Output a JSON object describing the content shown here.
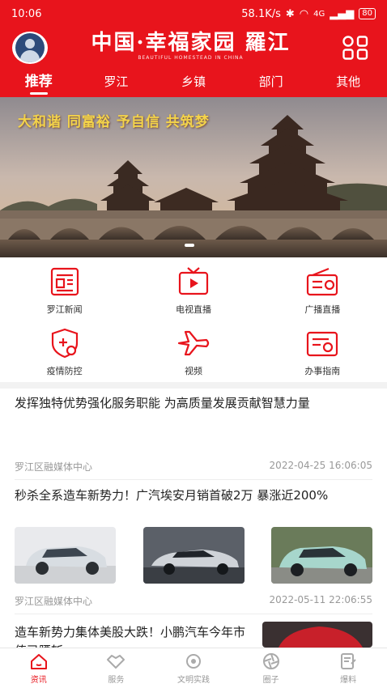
{
  "status_bar": {
    "time": "10:06",
    "network_speed": "58.1K/s",
    "signal": "4G",
    "battery": "80"
  },
  "header": {
    "logo_text": "中国·幸福家园 羅江",
    "logo_subtitle": "BEAUTIFUL HOMESTEAD IN CHINA"
  },
  "nav": {
    "tabs": [
      "推荐",
      "罗江",
      "乡镇",
      "部门",
      "其他"
    ]
  },
  "banner": {
    "slogan": "大和谐 同富裕 予自信 共筑梦"
  },
  "quick_links": [
    {
      "label": "罗江新闻",
      "icon": "newspaper-icon"
    },
    {
      "label": "电视直播",
      "icon": "tv-icon"
    },
    {
      "label": "广播直播",
      "icon": "radio-icon"
    },
    {
      "label": "疫情防控",
      "icon": "shield-plus-icon"
    },
    {
      "label": "视频",
      "icon": "airplane-icon"
    },
    {
      "label": "办事指南",
      "icon": "service-card-icon"
    }
  ],
  "news": [
    {
      "title": "发挥独特优势强化服务职能 为高质量发展贡献智慧力量",
      "source": "罗江区融媒体中心",
      "time": "2022-04-25 16:06:05"
    },
    {
      "title": "秒杀全系造车新势力！广汽埃安月销首破2万 暴涨近200%",
      "source": "罗江区融媒体中心",
      "time": "2022-05-11 22:06:55"
    },
    {
      "title": "造车新势力集体美股大跌！小鹏汽车今年市值已腰斩"
    }
  ],
  "tabbar": {
    "tabs": [
      "资讯",
      "服务",
      "文明实践",
      "圈子",
      "爆料"
    ]
  },
  "colors": {
    "brand_red": "#e8141c"
  }
}
